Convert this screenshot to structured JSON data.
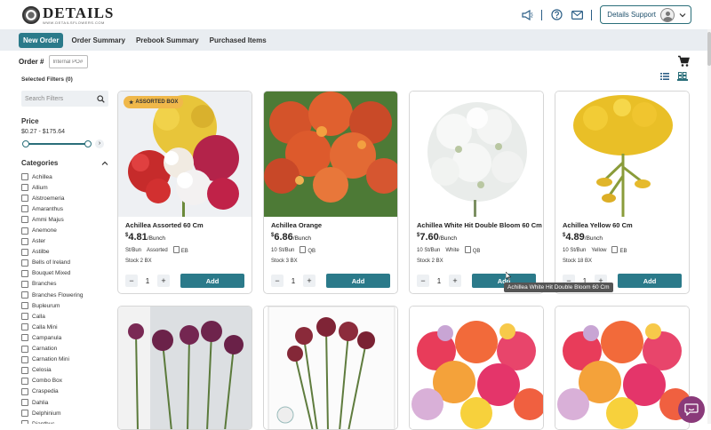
{
  "brand": {
    "name": "DETAILS",
    "url": "WWW.DETAILSFLOWERS.COM"
  },
  "header": {
    "support_label": "Details Support"
  },
  "nav": {
    "tabs": [
      "New Order",
      "Order Summary",
      "Prebook Summary",
      "Purchased Items"
    ],
    "active": "New Order"
  },
  "order": {
    "label": "Order #",
    "input_placeholder": "Internal PO#"
  },
  "filters": {
    "selected_label": "Selected Filters (0)",
    "search_placeholder": "Search Filters",
    "price_title": "Price",
    "price_range": "$0.27 - $175.64",
    "price_min_fraction": 0.0,
    "price_max_fraction": 1.0,
    "categories_title": "Categories",
    "categories": [
      "Achillea",
      "Allium",
      "Alstroemeria",
      "Amaranthus",
      "Ammi Majus",
      "Anemone",
      "Aster",
      "Astilbe",
      "Bells of Ireland",
      "Bouquet Mixed",
      "Branches",
      "Branches Flowering",
      "Bupleurum",
      "Calla",
      "Calla Mini",
      "Campanula",
      "Carnation",
      "Carnation Mini",
      "Celosia",
      "Combo Box",
      "Craspedia",
      "Dahlia",
      "Delphinium",
      "Dianthus"
    ]
  },
  "products": [
    {
      "name": "Achillea Assorted 60 Cm",
      "price_dollar": "$",
      "price_main": "4.81",
      "price_unit": "/Bunch",
      "stems": "St/Bun",
      "color": "Assorted",
      "box": "EB",
      "stock": "Stock 2 BX",
      "qty": "1",
      "add_label": "Add",
      "badge": "ASSORTED BOX"
    },
    {
      "name": "Achillea Orange",
      "price_dollar": "$",
      "price_main": "6.86",
      "price_unit": "/Bunch",
      "stems": "10 St/Bun",
      "color": "",
      "box": "QB",
      "stock": "Stock 3 BX",
      "qty": "1",
      "add_label": "Add"
    },
    {
      "name": "Achillea White Hit Double Bloom 60 Cm",
      "price_dollar": "$",
      "price_main": "7.60",
      "price_unit": "/Bunch",
      "stems": "10 St/Bun",
      "color": "White",
      "box": "QB",
      "stock": "Stock 2 BX",
      "qty": "1",
      "add_label": "Add"
    },
    {
      "name": "Achillea Yellow 60 Cm",
      "price_dollar": "$",
      "price_main": "4.89",
      "price_unit": "/Bunch",
      "stems": "10 St/Bun",
      "color": "Yellow",
      "box": "EB",
      "stock": "Stock 18 BX",
      "qty": "1",
      "add_label": "Add"
    }
  ],
  "tooltip": "Achillea White Hit Double Bloom 60 Cm",
  "colors": {
    "accent": "#2b7a8a",
    "nav_bg": "#e9edf1",
    "badge": "#f0b84a",
    "chat": "#8a3a7a"
  }
}
